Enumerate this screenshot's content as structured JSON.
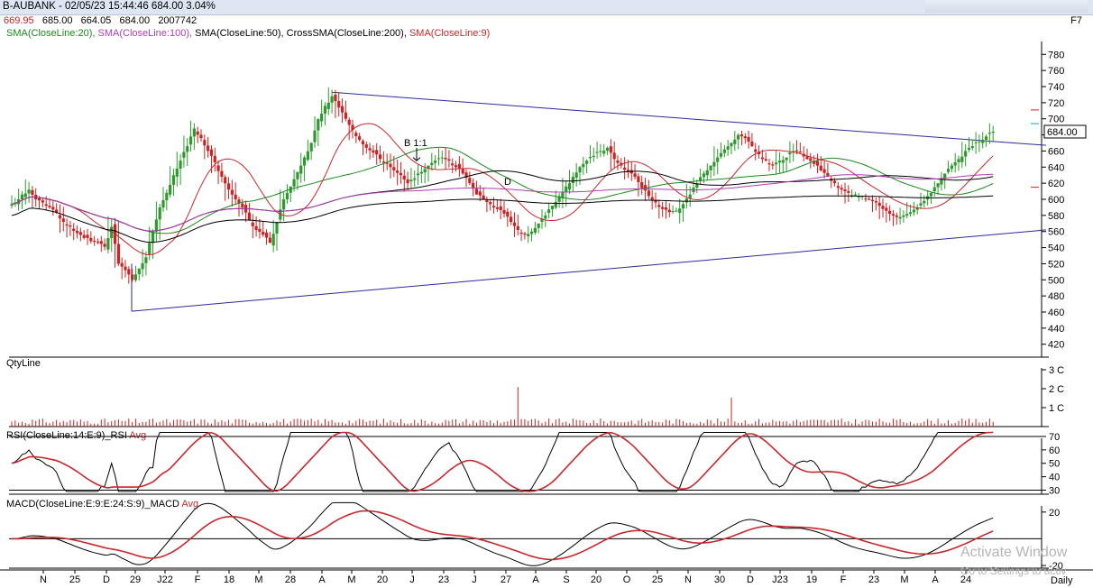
{
  "window": {
    "title": "B-AUBANK - 02/05/23 15:44:46 684.00 3.04%",
    "shortcut": "F7"
  },
  "ohlc": {
    "open": "669.95",
    "high": "685.00",
    "low": "664.05",
    "close": "684.00",
    "volume": "2007742"
  },
  "indicators": [
    {
      "label": "SMA(CloseLine:20),",
      "color": "#1a8a1a"
    },
    {
      "label": "SMA(CloseLine:100),",
      "color": "#b23cb2"
    },
    {
      "label": "SMA(CloseLine:50),",
      "color": "#000000"
    },
    {
      "label": "CrossSMA(CloseLine:200),",
      "color": "#000000"
    },
    {
      "label": "SMA(CloseLine:9)",
      "color": "#c8282d"
    }
  ],
  "colors": {
    "up": "#2e9a2e",
    "down": "#cc2222",
    "trendline": "#2a2a9a",
    "volume": "#cc2222"
  },
  "chart_data": [
    {
      "type": "candlestick",
      "ylim": [
        404,
        796
      ],
      "y_ticks": [
        780,
        760,
        740,
        720,
        700,
        680,
        660,
        640,
        620,
        600,
        580,
        560,
        540,
        520,
        500,
        480,
        460,
        440,
        420
      ],
      "last_price_label": "684.00",
      "annotations": [
        "B 1:1",
        "D"
      ],
      "x_ticks": [
        "N",
        "25",
        "D",
        "29",
        "J22",
        "F",
        "18",
        "M",
        "28",
        "A",
        "M",
        "20",
        "J",
        "23",
        "J",
        "27",
        "A",
        "S",
        "20",
        "O",
        "25",
        "N",
        "30",
        "D",
        "J23",
        "19",
        "F",
        "23",
        "M",
        "A",
        "24"
      ],
      "close_series": [
        596,
        606,
        612,
        600,
        596,
        590,
        584,
        572,
        566,
        558,
        552,
        548,
        546,
        541,
        566,
        520,
        512,
        500,
        514,
        528,
        560,
        590,
        608,
        630,
        648,
        666,
        688,
        676,
        660,
        646,
        628,
        612,
        600,
        590,
        574,
        562,
        556,
        546,
        572,
        600,
        616,
        634,
        652,
        670,
        700,
        716,
        728,
        714,
        700,
        686,
        674,
        664,
        658,
        650,
        644,
        636,
        630,
        620,
        626,
        634,
        642,
        648,
        652,
        648,
        640,
        632,
        620,
        606,
        600,
        594,
        588,
        582,
        572,
        562,
        556,
        560,
        570,
        580,
        592,
        604,
        616,
        628,
        640,
        648,
        654,
        660,
        664,
        650,
        642,
        634,
        628,
        614,
        604,
        596,
        588,
        584,
        586,
        594,
        606,
        620,
        632,
        642,
        652,
        662,
        670,
        680,
        676,
        666,
        656,
        648,
        642,
        648,
        652,
        660,
        658,
        650,
        644,
        636,
        628,
        620,
        612,
        608,
        606,
        604,
        600,
        596,
        588,
        582,
        578,
        580,
        584,
        590,
        598,
        608,
        620,
        632,
        642,
        650,
        660,
        666,
        672,
        678,
        684
      ]
    },
    {
      "type": "bar",
      "title": "QtyLine",
      "y_ticks": [
        "3 C",
        "2 C",
        "1 C"
      ]
    },
    {
      "type": "line",
      "title": "RSI(CloseLine:14:E:9)_RSI",
      "avg_label": "Avg",
      "ylim": [
        27,
        74
      ],
      "y_ticks": [
        70,
        60,
        50,
        40,
        30
      ],
      "reference_lines": [
        70,
        30
      ]
    },
    {
      "type": "line",
      "title": "MACD(CloseLine:E:9:E:24:S:9)_MACD",
      "avg_label": "Avg",
      "ylim": [
        -22,
        30
      ],
      "y_ticks": [
        20,
        -20
      ]
    }
  ],
  "x_axis": {
    "labels": [
      "N",
      "25",
      "D",
      "29",
      "J22",
      "F",
      "18",
      "M",
      "28",
      "A",
      "M",
      "20",
      "J",
      "23",
      "J",
      "27",
      "A",
      "S",
      "20",
      "O",
      "25",
      "N",
      "30",
      "D",
      "J23",
      "19",
      "F",
      "23",
      "M",
      "A",
      "24"
    ],
    "period": "Daily"
  },
  "watermark": {
    "line1": "Activate Window",
    "line2": "Go to Settings to activ"
  }
}
